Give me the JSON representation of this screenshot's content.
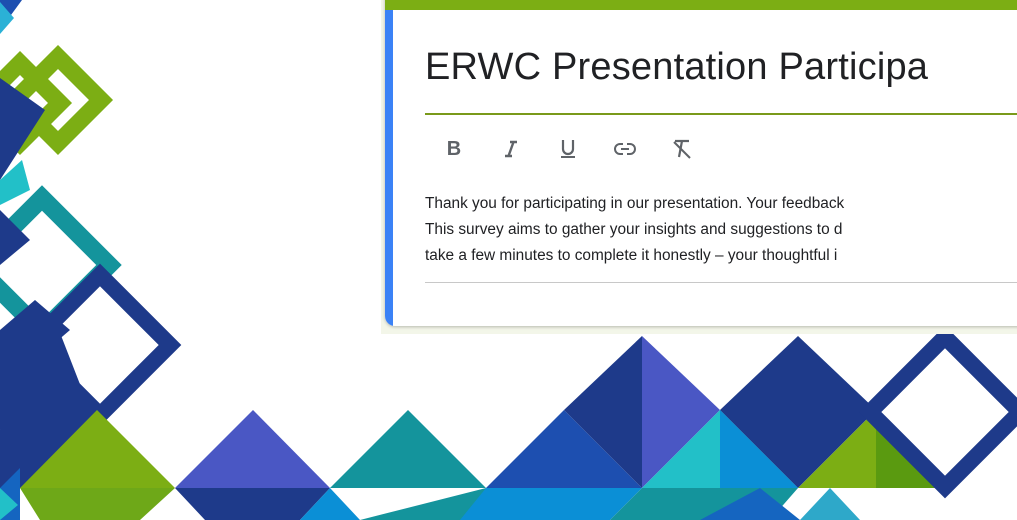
{
  "form": {
    "title": "ERWC Presentation Participa",
    "description_lines": [
      "Thank you for participating in our presentation. Your feedback",
      "This survey aims to gather your insights and suggestions to d",
      "take a few minutes to complete it honestly – your thoughtful i"
    ]
  },
  "toolbar": {
    "bold_label": "B",
    "italic_icon": "italic-icon",
    "underline_icon": "underline-icon",
    "link_icon": "link-icon",
    "clear_format_icon": "clear-formatting-icon"
  },
  "colors": {
    "header_accent": "#7cae14",
    "left_accent": "#3b82f6",
    "title_underline": "#7a9a1a",
    "deco_navy": "#1e3a8a",
    "deco_royal": "#1d4fb0",
    "deco_blue": "#1565c0",
    "deco_periwinkle": "#4a57c4",
    "deco_teal": "#14949c",
    "deco_cyan": "#22c0c8",
    "deco_sky": "#0b8fd6",
    "deco_green": "#7cae14"
  }
}
